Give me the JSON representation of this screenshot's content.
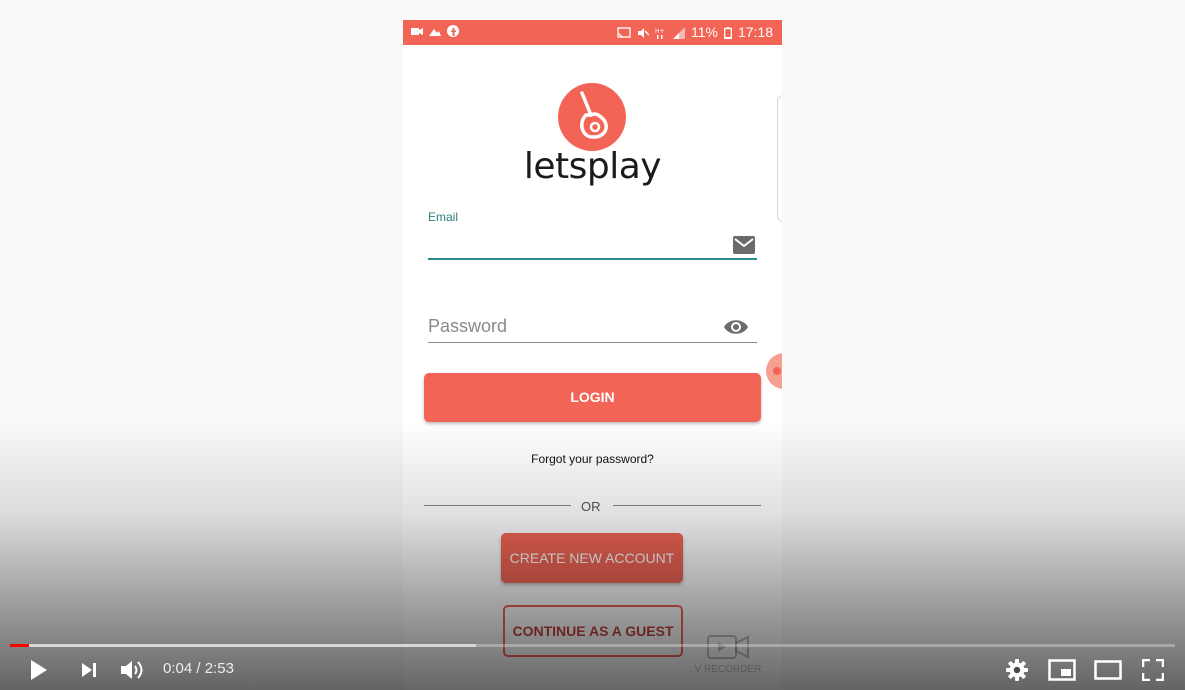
{
  "phone": {
    "status_bar": {
      "battery": "11%",
      "clock": "17:18"
    },
    "logo_text": "letsplay",
    "email": {
      "label": "Email",
      "value": ""
    },
    "password": {
      "placeholder": "Password",
      "value": ""
    },
    "login_label": "LOGIN",
    "forgot_label": "Forgot your password?",
    "divider_label": "OR",
    "create_account_label": "CREATE NEW ACCOUNT",
    "guest_label": "CONTINUE AS A GUEST",
    "watermark_text": "V RECORDER"
  },
  "player": {
    "current_time": "0:04",
    "separator": " / ",
    "duration": "2:53",
    "progress_played_fraction": 0.016,
    "progress_buffered_fraction": 0.4
  },
  "colors": {
    "accent": "#f26556",
    "field_accent": "#2a8b88",
    "progress": "#ff0000"
  },
  "icons": {
    "status_left": [
      "video-recorder-icon",
      "image-icon",
      "facebook-icon"
    ],
    "status_right": [
      "cast-icon",
      "mute-icon",
      "network-icon",
      "signal-icon",
      "battery-icon"
    ],
    "email_field": "mail-icon",
    "password_field": "eye-icon",
    "player_left": [
      "play-icon",
      "next-icon",
      "volume-icon"
    ],
    "player_right": [
      "settings-icon",
      "miniplayer-icon",
      "theater-mode-icon",
      "fullscreen-icon"
    ]
  }
}
